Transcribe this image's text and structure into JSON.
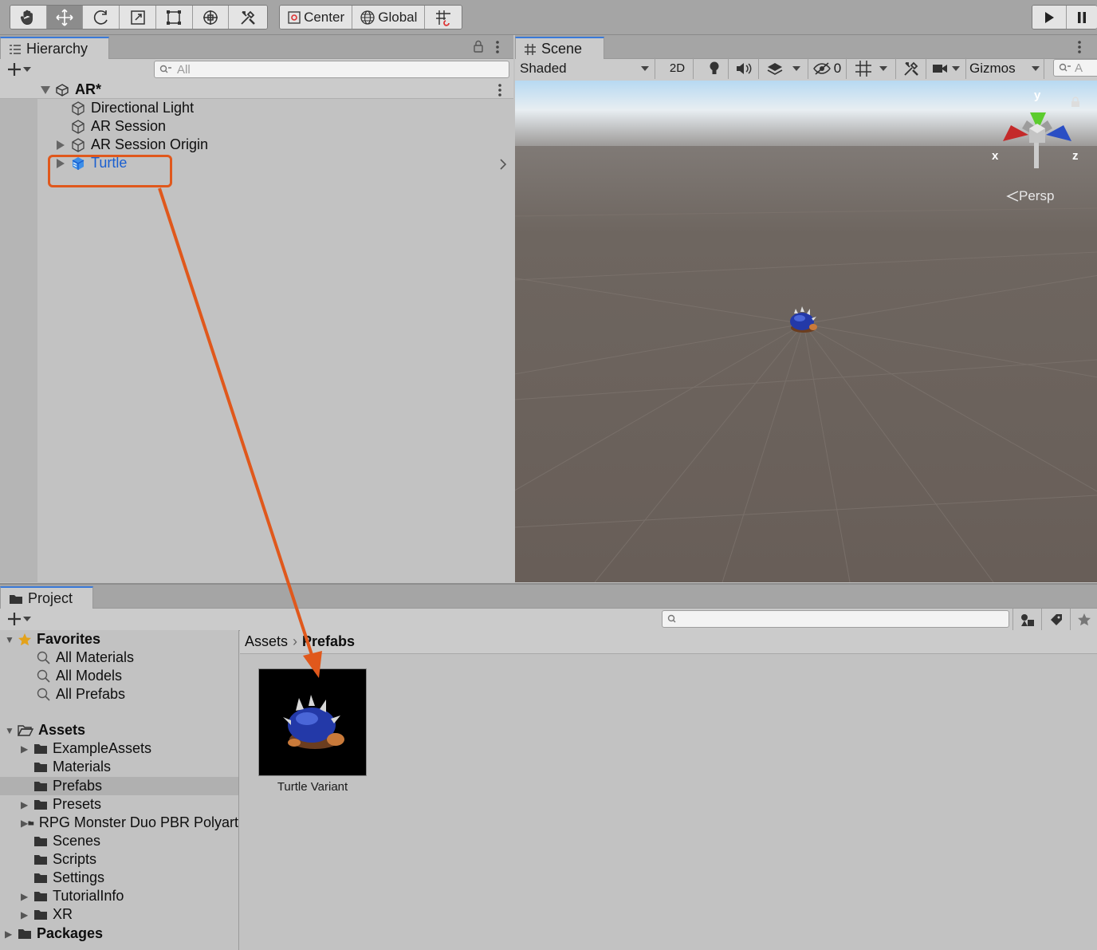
{
  "toolbar": {
    "tools": [
      "hand-tool",
      "move-tool",
      "rotate-tool",
      "scale-tool",
      "rect-tool",
      "transform-tool",
      "custom-editor-tool"
    ],
    "pivot_label": "Center",
    "space_label": "Global"
  },
  "hierarchy": {
    "tab_label": "Hierarchy",
    "search_placeholder": "All",
    "scene_name": "AR*",
    "items": [
      {
        "label": "Directional Light"
      },
      {
        "label": "AR Session"
      },
      {
        "label": "AR Session Origin"
      },
      {
        "label": "Turtle"
      }
    ]
  },
  "scene": {
    "tab_label": "Scene",
    "shading_mode": "Shaded",
    "mode_2d_label": "2D",
    "hidden_count": "0",
    "gizmos_label": "Gizmos",
    "search_placeholder": "A",
    "gizmo_axis_y": "y",
    "gizmo_axis_x": "x",
    "gizmo_axis_z": "z",
    "projection_label": "Persp"
  },
  "project": {
    "tab_label": "Project",
    "favorites": {
      "label": "Favorites",
      "items": [
        "All Materials",
        "All Models",
        "All Prefabs"
      ]
    },
    "assets": {
      "label": "Assets",
      "items": [
        "ExampleAssets",
        "Materials",
        "Prefabs",
        "Presets",
        "RPG Monster Duo PBR Polyart",
        "Scenes",
        "Scripts",
        "Settings",
        "TutorialInfo",
        "XR"
      ]
    },
    "packages_label": "Packages",
    "breadcrumb": [
      "Assets",
      "Prefabs"
    ],
    "asset_tile_label": "Turtle Variant"
  },
  "colors": {
    "selection_blue": "#1a5fd0",
    "annotation_orange": "#e0581c",
    "scene_ground": "#685e58"
  }
}
